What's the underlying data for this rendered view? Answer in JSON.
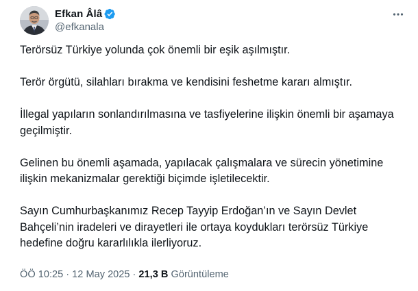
{
  "user": {
    "display_name": "Efkan Âlâ",
    "handle": "@efkanala",
    "verified": true
  },
  "icons": {
    "verified": "verified-badge-icon",
    "more": "more-options-icon"
  },
  "colors": {
    "verified_blue": "#1d9bf0",
    "text_primary": "#0f1419",
    "text_secondary": "#536471"
  },
  "tweet": {
    "paragraphs": [
      "Terörsüz Türkiye yolunda çok önemli bir eşik aşılmıştır.",
      "Terör örgütü, silahları bırakma ve kendisini feshetme kararı almıştır.",
      "İllegal yapıların sonlandırılmasına ve tasfiyelerine ilişkin önemli bir aşamaya geçilmiştir.",
      "Gelinen bu önemli aşamada, yapılacak çalışmalara ve sürecin yönetimine ilişkin mekanizmalar gerektiği biçimde işletilecektir.",
      "Sayın Cumhurbaşkanımız Recep Tayyip Erdoğan’ın ve Sayın Devlet Bahçeli’nin iradeleri ve dirayetleri ile ortaya koydukları terörsüz Türkiye hedefine doğru kararlılıkla ilerliyoruz."
    ]
  },
  "meta": {
    "time": "ÖÖ 10:25",
    "separator1": "·",
    "date": "12 May 2025",
    "separator2": "·",
    "views_count": "21,3 B",
    "views_label": "Görüntüleme"
  }
}
